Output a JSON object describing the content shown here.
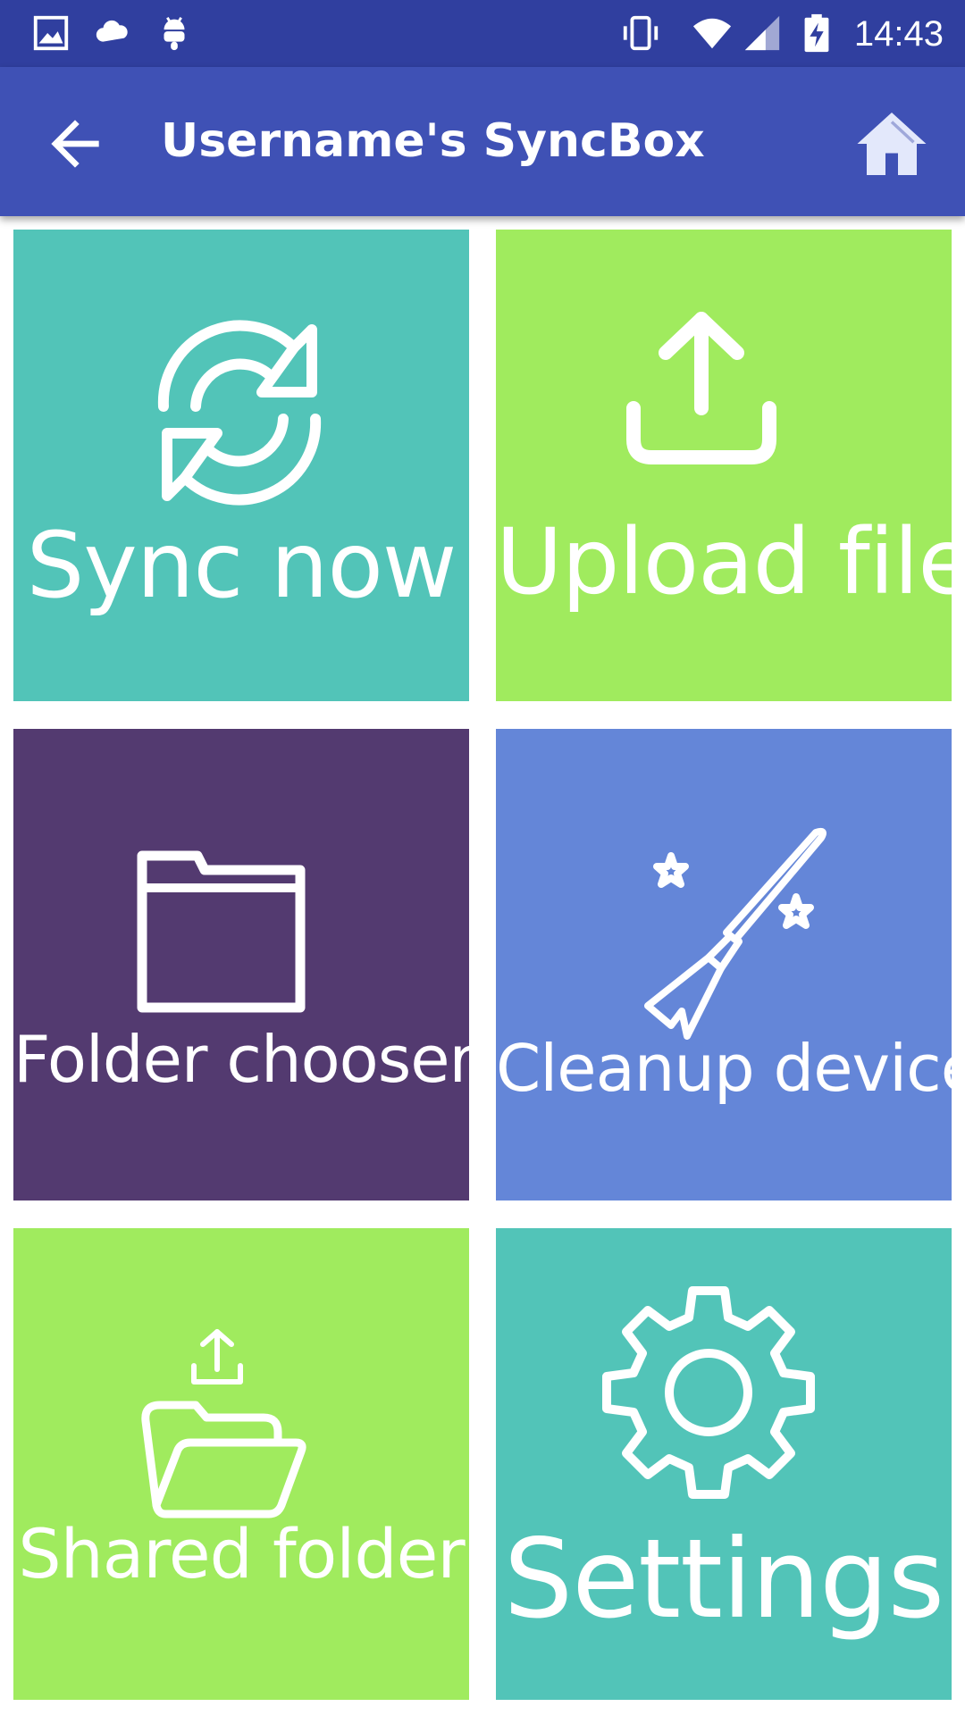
{
  "status_bar": {
    "time": "14:43",
    "icons": [
      "image-icon",
      "cloud-icon",
      "android-icon",
      "vibrate-icon",
      "wifi-icon",
      "cell-signal-icon",
      "battery-charging-icon"
    ]
  },
  "app_bar": {
    "title": "Username's SyncBox",
    "background": "#3f51b5",
    "status_bar_background": "#303f9f",
    "back_icon": "arrow-back-icon",
    "home_icon": "home-icon"
  },
  "tiles": [
    {
      "label": "Sync now",
      "color": "#52c4b8",
      "icon": "sync-icon"
    },
    {
      "label": "Upload file",
      "color": "#a0eb5e",
      "icon": "upload-icon"
    },
    {
      "label": "Folder chooser",
      "color": "#533a70",
      "icon": "folder-icon"
    },
    {
      "label": "Cleanup device",
      "color": "#6486d8",
      "icon": "broom-icon"
    },
    {
      "label": "Shared folder",
      "color": "#a0eb5e",
      "icon": "shared-folder-icon"
    },
    {
      "label": "Settings",
      "color": "#52c4b8",
      "icon": "gear-icon"
    }
  ]
}
